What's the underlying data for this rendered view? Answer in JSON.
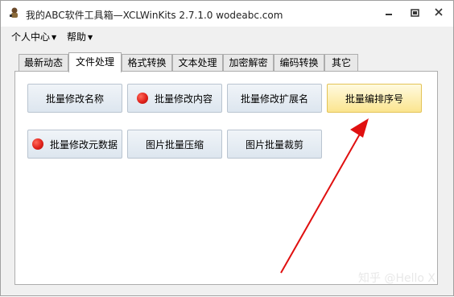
{
  "window": {
    "title": "我的ABC软件工具箱—XCLWinKits 2.7.1.0  wodeabc.com"
  },
  "menu": {
    "personal_center": "个人中心",
    "help": "帮助"
  },
  "tabs": [
    {
      "label": "最新动态",
      "active": false
    },
    {
      "label": "文件处理",
      "active": true
    },
    {
      "label": "格式转换",
      "active": false
    },
    {
      "label": "文本处理",
      "active": false
    },
    {
      "label": "加密解密",
      "active": false
    },
    {
      "label": "编码转换",
      "active": false
    },
    {
      "label": "其它",
      "active": false
    }
  ],
  "buttons": {
    "batch_rename": "批量修改名称",
    "batch_modify_content": "批量修改内容",
    "batch_modify_ext": "批量修改扩展名",
    "batch_sort_number": "批量编排序号",
    "batch_modify_metadata": "批量修改元数据",
    "image_batch_compress": "图片批量压缩",
    "image_batch_crop": "图片批量裁剪"
  },
  "watermark": "知乎 @Hello X",
  "colors": {
    "highlight_button": "#fbe58f",
    "arrow": "#e01010",
    "status_dot": "#e0221b"
  }
}
